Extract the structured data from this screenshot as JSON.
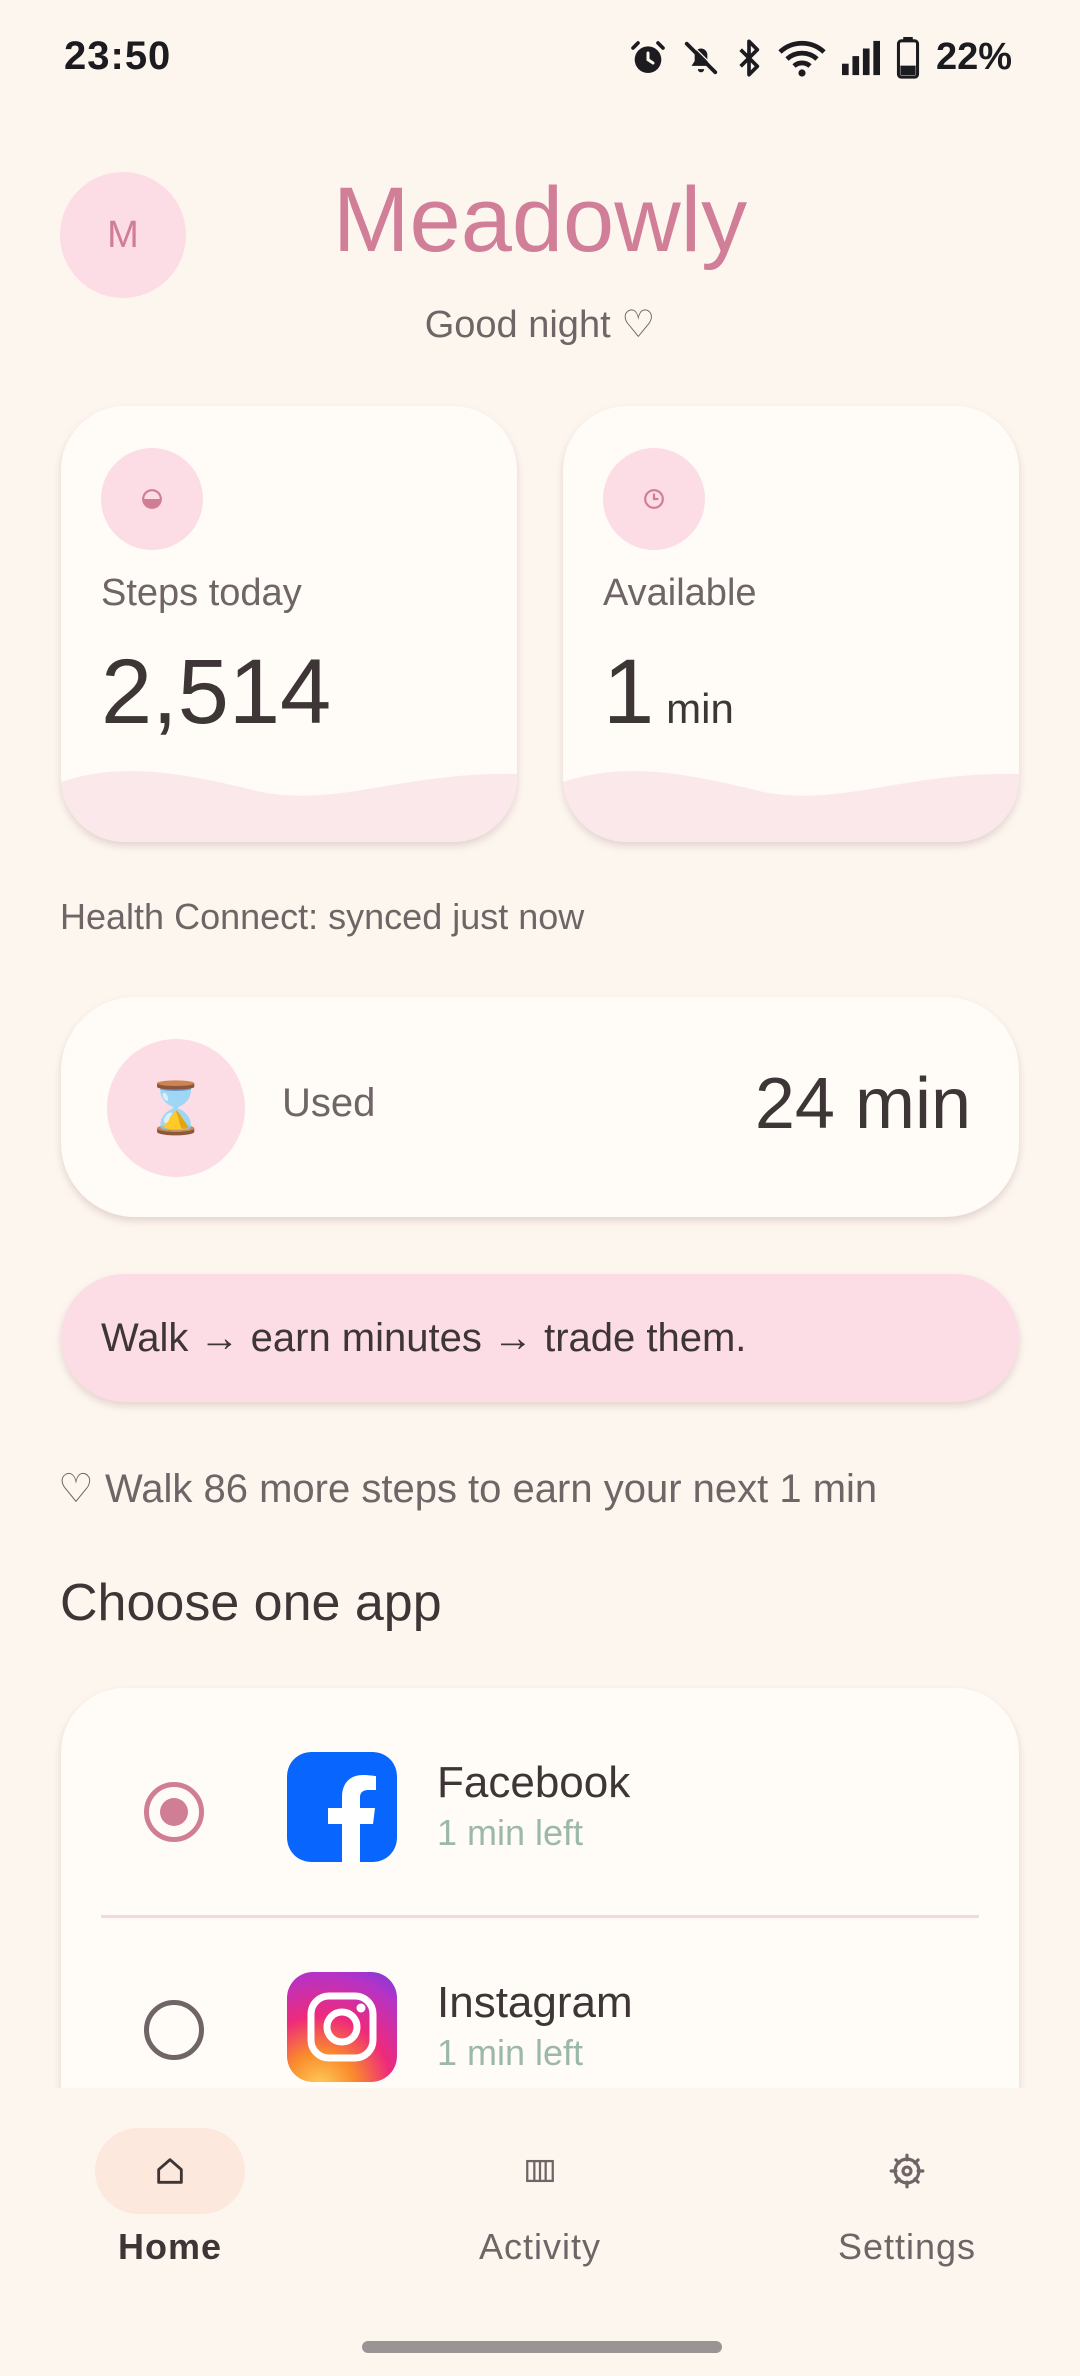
{
  "status_bar": {
    "time": "23:50",
    "battery": "22%",
    "icons": [
      "alarm-icon",
      "bell-off-icon",
      "bluetooth-icon",
      "wifi-icon",
      "signal-icon",
      "battery-icon"
    ]
  },
  "header": {
    "avatar_initial": "M",
    "title": "Meadowly",
    "greeting": "Good night ♡"
  },
  "cards": {
    "steps": {
      "label": "Steps today",
      "value": "2,514"
    },
    "available": {
      "label": "Available",
      "value": "1",
      "unit": "min"
    }
  },
  "sync_status": "Health Connect: synced just now",
  "used": {
    "icon": "⌛",
    "label": "Used",
    "value": "24 min"
  },
  "banner": "Walk → earn minutes → trade them.",
  "hint": "♡ Walk 86 more steps to earn your next 1 min",
  "section_title": "Choose one app",
  "apps": [
    {
      "name": "Facebook",
      "time_left": "1 min left",
      "selected": true
    },
    {
      "name": "Instagram",
      "time_left": "1 min left",
      "selected": false
    }
  ],
  "nav": [
    {
      "label": "Home",
      "active": true
    },
    {
      "label": "Activity",
      "active": false
    },
    {
      "label": "Settings",
      "active": false
    }
  ],
  "colors": {
    "background": "#fdf6ef",
    "accent_pink": "#cf7e96",
    "soft_pink": "#fcdce5",
    "card": "#fffbf6",
    "muted_green": "#9cb8a8"
  }
}
